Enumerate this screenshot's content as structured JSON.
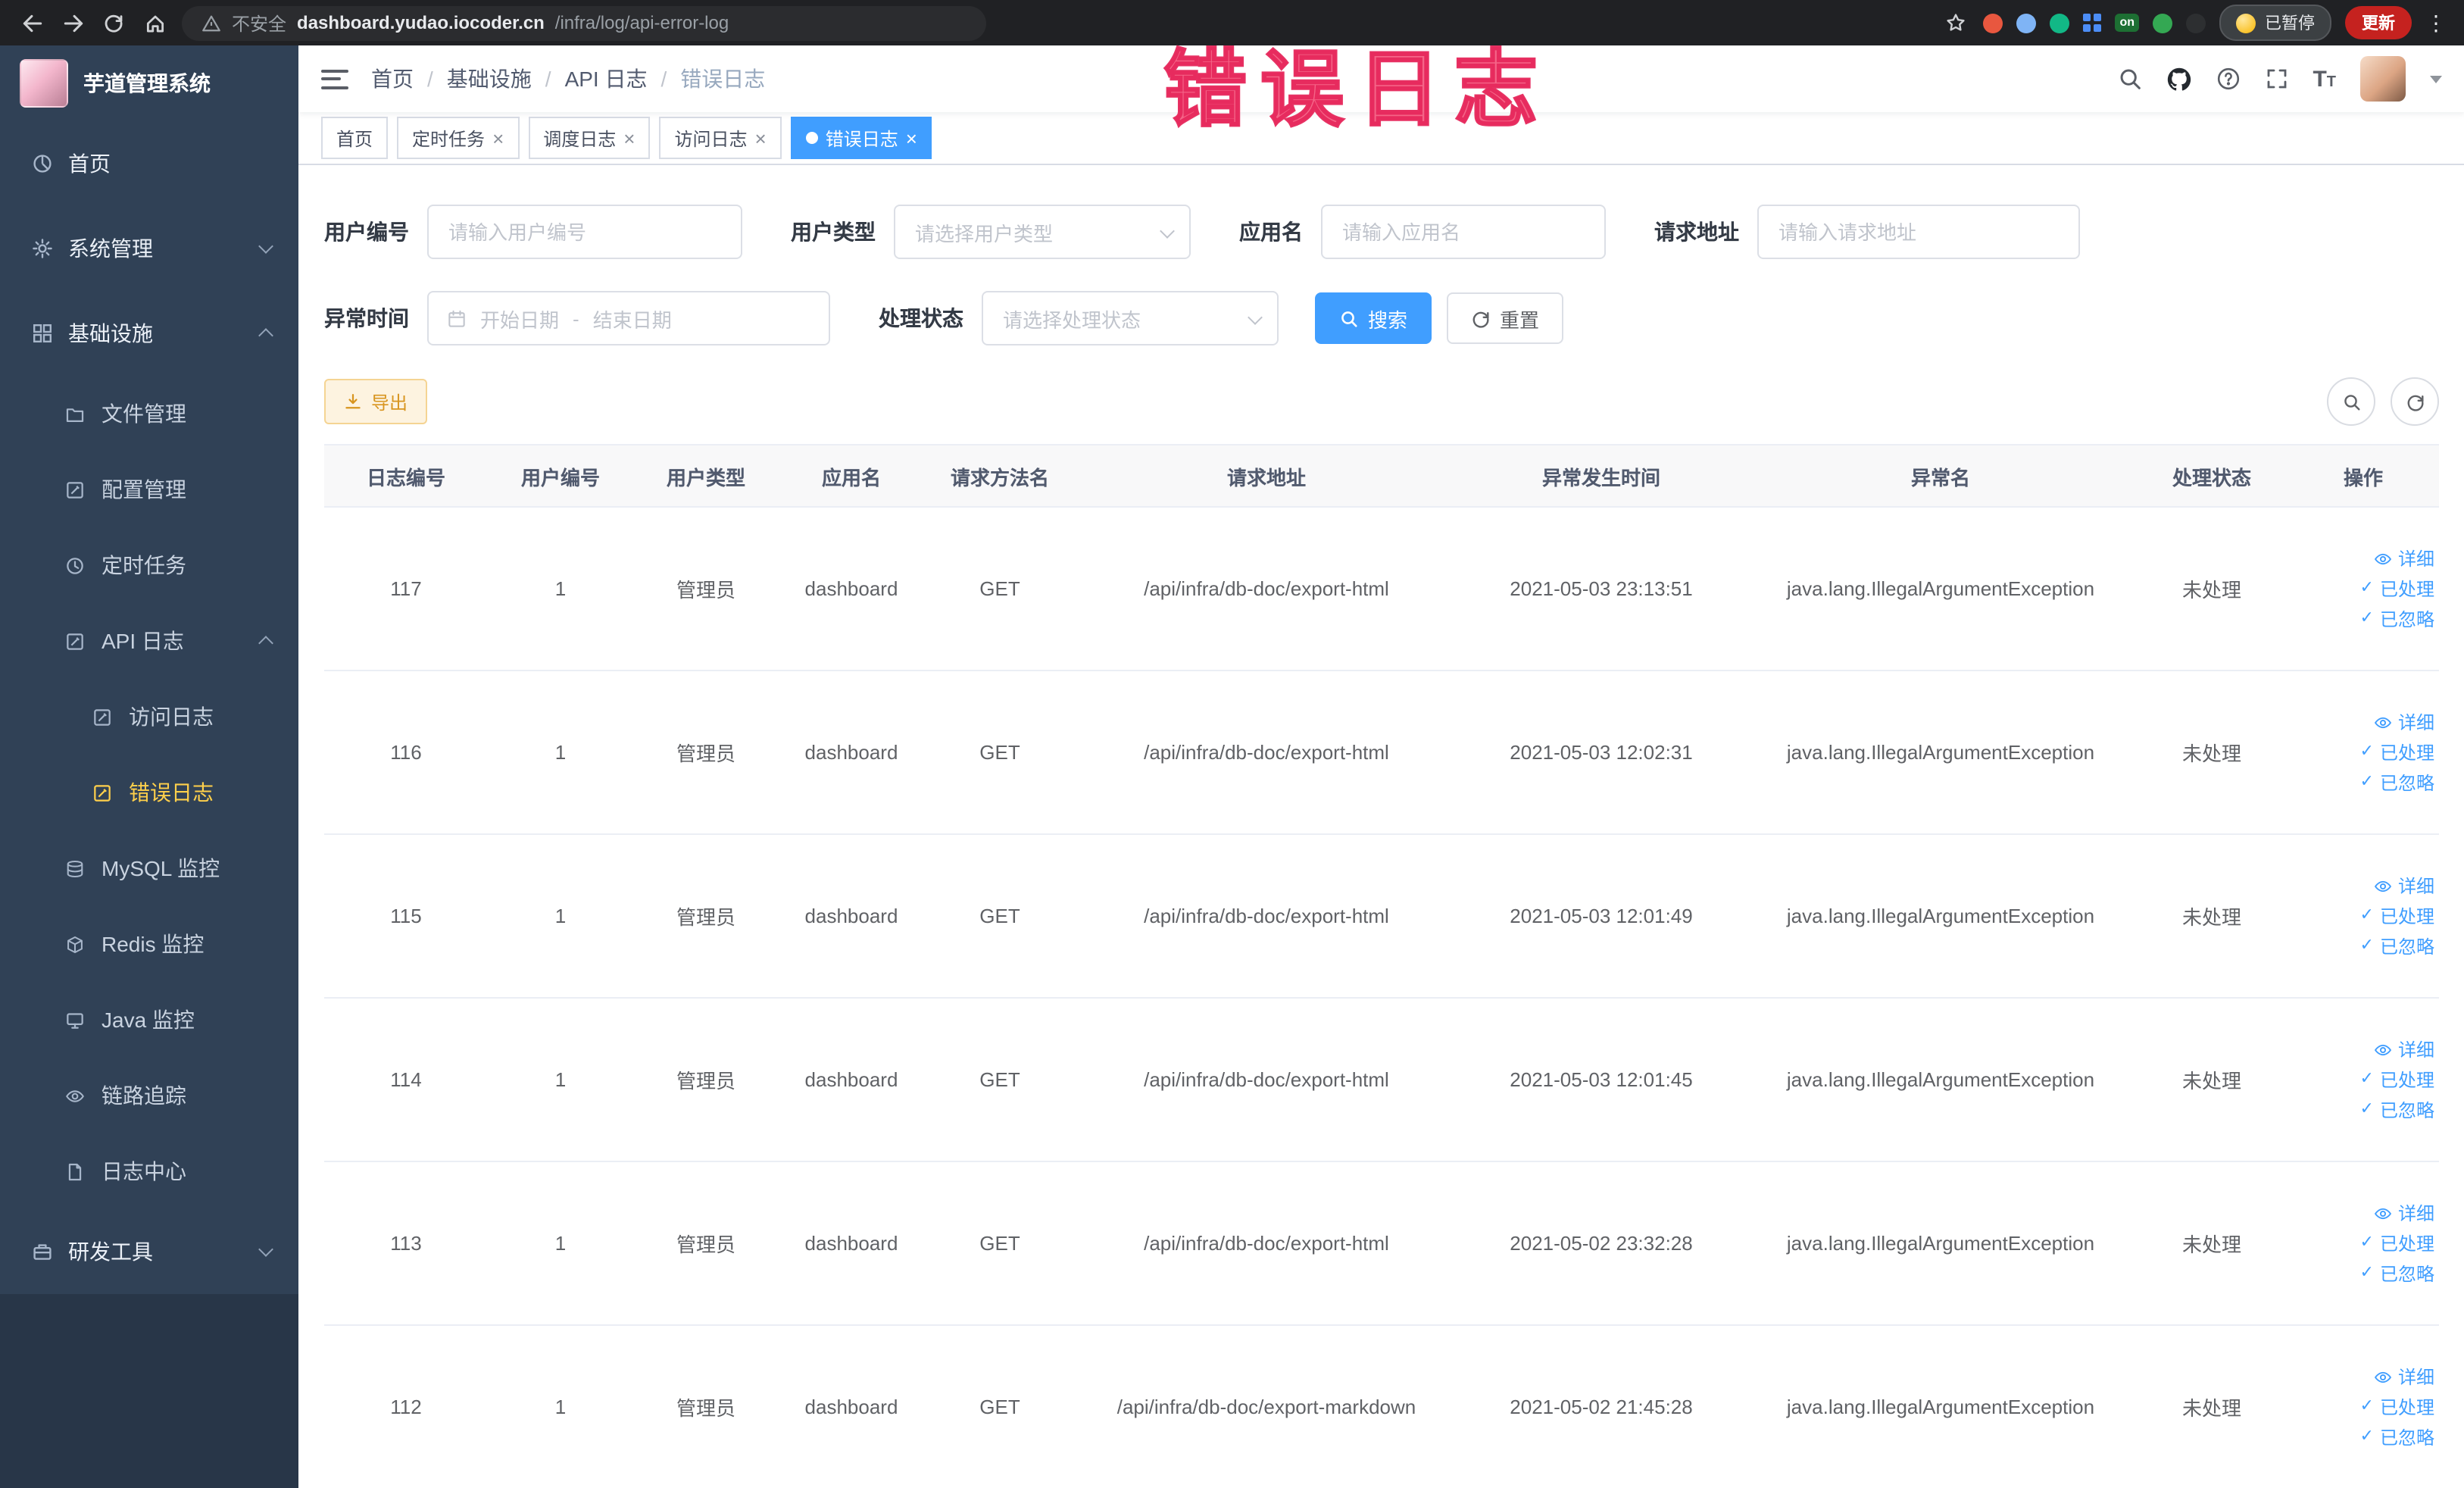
{
  "browser": {
    "security_label": "不安全",
    "url_host": "dashboard.yudao.iocoder.cn",
    "url_path": "/infra/log/api-error-log",
    "extension_badge_on": "on",
    "paused_badge": "已暂停",
    "update_button": "更新"
  },
  "annotation": "错误日志",
  "sidebar": {
    "logo_title": "芋道管理系统",
    "items": [
      "首页",
      "系统管理",
      "基础设施",
      "文件管理",
      "配置管理",
      "定时任务",
      "API 日志",
      "访问日志",
      "错误日志",
      "MySQL 监控",
      "Redis 监控",
      "Java 监控",
      "链路追踪",
      "日志中心",
      "研发工具"
    ]
  },
  "header": {
    "breadcrumb": [
      "首页",
      "基础设施",
      "API 日志",
      "错误日志"
    ]
  },
  "tabs": [
    "首页",
    "定时任务",
    "调度日志",
    "访问日志",
    "错误日志"
  ],
  "filters": {
    "user_id_label": "用户编号",
    "user_id_placeholder": "请输入用户编号",
    "user_type_label": "用户类型",
    "user_type_placeholder": "请选择用户类型",
    "app_name_label": "应用名",
    "app_name_placeholder": "请输入应用名",
    "request_url_label": "请求地址",
    "request_url_placeholder": "请输入请求地址",
    "exception_time_label": "异常时间",
    "date_start_placeholder": "开始日期",
    "date_separator": "-",
    "date_end_placeholder": "结束日期",
    "process_status_label": "处理状态",
    "process_status_placeholder": "请选择处理状态",
    "search_button": "搜索",
    "reset_button": "重置"
  },
  "toolbar": {
    "export_label": "导出"
  },
  "table": {
    "columns": [
      "日志编号",
      "用户编号",
      "用户类型",
      "应用名",
      "请求方法名",
      "请求地址",
      "异常发生时间",
      "异常名",
      "处理状态",
      "操作"
    ],
    "actions": {
      "detail": "详细",
      "processed": "已处理",
      "ignored": "已忽略"
    },
    "rows": [
      {
        "id": "117",
        "user_id": "1",
        "user_type": "管理员",
        "app_name": "dashboard",
        "method": "GET",
        "url": "/api/infra/db-doc/export-html",
        "time": "2021-05-03 23:13:51",
        "exception": "java.lang.IllegalArgumentException",
        "status": "未处理"
      },
      {
        "id": "116",
        "user_id": "1",
        "user_type": "管理员",
        "app_name": "dashboard",
        "method": "GET",
        "url": "/api/infra/db-doc/export-html",
        "time": "2021-05-03 12:02:31",
        "exception": "java.lang.IllegalArgumentException",
        "status": "未处理"
      },
      {
        "id": "115",
        "user_id": "1",
        "user_type": "管理员",
        "app_name": "dashboard",
        "method": "GET",
        "url": "/api/infra/db-doc/export-html",
        "time": "2021-05-03 12:01:49",
        "exception": "java.lang.IllegalArgumentException",
        "status": "未处理"
      },
      {
        "id": "114",
        "user_id": "1",
        "user_type": "管理员",
        "app_name": "dashboard",
        "method": "GET",
        "url": "/api/infra/db-doc/export-html",
        "time": "2021-05-03 12:01:45",
        "exception": "java.lang.IllegalArgumentException",
        "status": "未处理"
      },
      {
        "id": "113",
        "user_id": "1",
        "user_type": "管理员",
        "app_name": "dashboard",
        "method": "GET",
        "url": "/api/infra/db-doc/export-html",
        "time": "2021-05-02 23:32:28",
        "exception": "java.lang.IllegalArgumentException",
        "status": "未处理"
      },
      {
        "id": "112",
        "user_id": "1",
        "user_type": "管理员",
        "app_name": "dashboard",
        "method": "GET",
        "url": "/api/infra/db-doc/export-markdown",
        "time": "2021-05-02 21:45:28",
        "exception": "java.lang.IllegalArgumentException",
        "status": "未处理"
      }
    ]
  },
  "colors": {
    "primary": "#409eff",
    "sidebar_bg": "#304156",
    "active_menu_text": "#ffd04b",
    "annotation": "#f3436e"
  }
}
